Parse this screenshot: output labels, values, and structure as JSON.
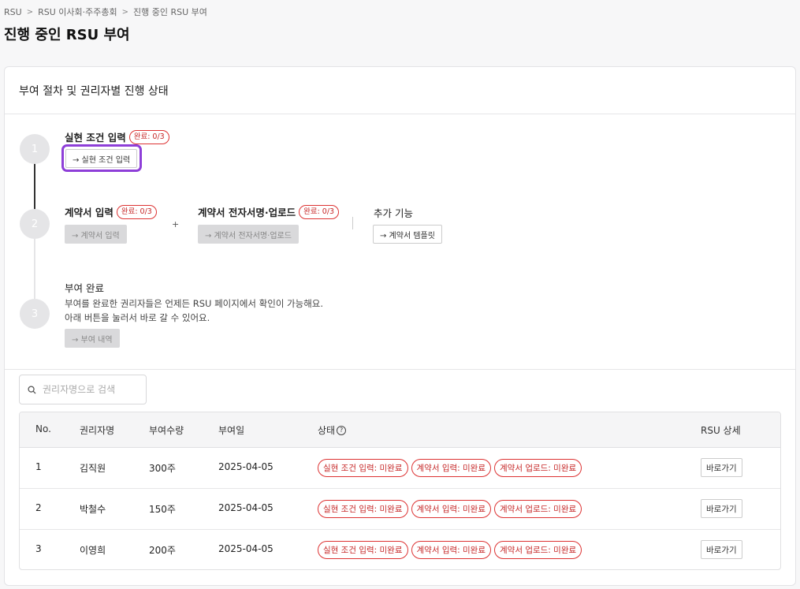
{
  "breadcrumb": [
    "RSU",
    "RSU 이사회·주주총회",
    "진행 중인 RSU 부여"
  ],
  "page_title": "진행 중인 RSU 부여",
  "card_title": "부여 절차 및 권리자별 진행 상태",
  "steps": [
    {
      "number": "1",
      "title": "실현 조건 입력",
      "badge": "완료: 0/3",
      "button": "→ 실현 조건 입력"
    },
    {
      "number": "2",
      "title": "계약서 입력",
      "badge": "완료: 0/3",
      "button": "→ 계약서 입력",
      "plus": "+",
      "title2": "계약서 전자서명·업로드",
      "badge2": "완료: 0/3",
      "button2": "→ 계약서 전자서명·업로드",
      "extra_title": "추가 기능",
      "extra_button": "→ 계약서 템플릿"
    },
    {
      "number": "3",
      "title": "부여 완료",
      "desc1": "부여를 완료한 권리자들은 언제든 RSU 페이지에서 확인이 가능해요.",
      "desc2": "아래 버튼을 눌러서 바로 갈 수 있어요.",
      "button": "→ 부여 내역"
    }
  ],
  "search": {
    "placeholder": "권리자명으로 검색"
  },
  "table": {
    "headers": [
      "No.",
      "권리자명",
      "부여수량",
      "부여일",
      "상태",
      "RSU 상세"
    ],
    "rows": [
      {
        "no": "1",
        "name": "김직원",
        "qty": "300주",
        "date": "2025-04-05",
        "statuses": [
          "실현 조건 입력: 미완료",
          "계약서 입력: 미완료",
          "계약서 업로드: 미완료"
        ],
        "action": "바로가기"
      },
      {
        "no": "2",
        "name": "박철수",
        "qty": "150주",
        "date": "2025-04-05",
        "statuses": [
          "실현 조건 입력: 미완료",
          "계약서 입력: 미완료",
          "계약서 업로드: 미완료"
        ],
        "action": "바로가기"
      },
      {
        "no": "3",
        "name": "이영희",
        "qty": "200주",
        "date": "2025-04-05",
        "statuses": [
          "실현 조건 입력: 미완료",
          "계약서 입력: 미완료",
          "계약서 업로드: 미완료"
        ],
        "action": "바로가기"
      }
    ]
  },
  "colors": {
    "accent_highlight": "#8e3fd8",
    "status_red": "#c62828",
    "active_line": "#333333",
    "inactive_line": "#e5e5e7"
  }
}
